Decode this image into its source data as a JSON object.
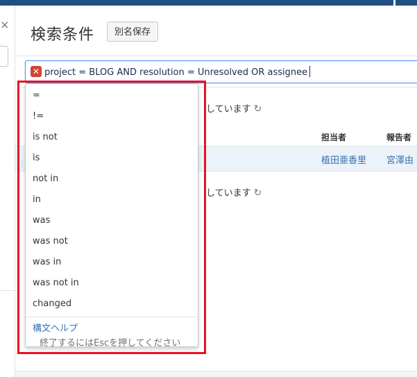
{
  "header": {
    "title": "検索条件",
    "save_as_label": "別名保存"
  },
  "left_panel": {
    "close_glyph": "×"
  },
  "query": {
    "text": "project = BLOG AND resolution = Unresolved OR assignee",
    "error_glyph": "✕"
  },
  "status": {
    "line1": "しています",
    "line2": "しています"
  },
  "table": {
    "columns": [
      "担当者",
      "報告者"
    ],
    "row": {
      "assignee": "植田亜香里",
      "reporter": "宮澤由"
    }
  },
  "dropdown": {
    "operators": [
      "=",
      "!=",
      "is not",
      "is",
      "not in",
      "in",
      "was",
      "was not",
      "was in",
      "was not in",
      "changed"
    ],
    "help_label": "構文ヘルプ",
    "esc_hint": "終了するにはEscを押してください"
  },
  "colors": {
    "topbar": "#205081",
    "link": "#3572b0",
    "error": "#d04437",
    "highlight": "#e81123",
    "focus": "#4c9aff"
  },
  "icons": {
    "refresh": "refresh-icon",
    "error": "error-icon",
    "close": "close-icon"
  }
}
